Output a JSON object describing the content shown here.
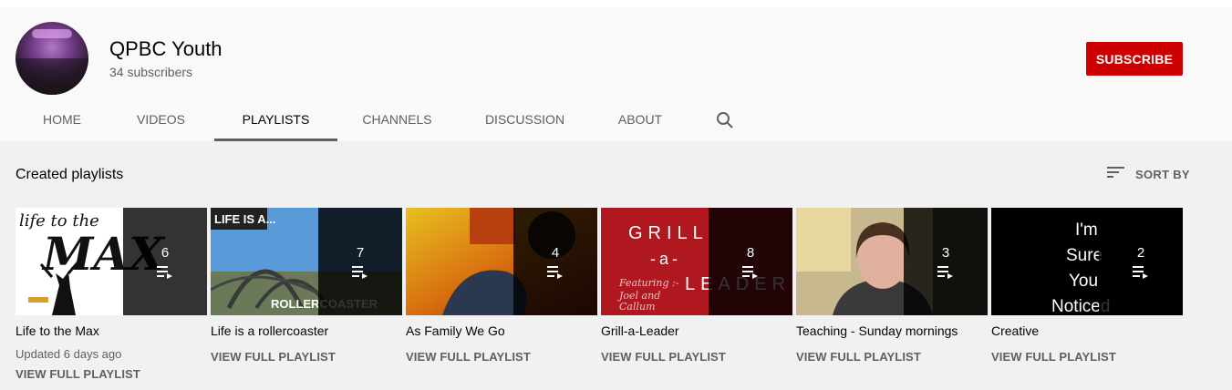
{
  "channel": {
    "name": "QPBC Youth",
    "subscribers": "34 subscribers",
    "subscribe_label": "SUBSCRIBE"
  },
  "tabs": [
    {
      "label": "HOME"
    },
    {
      "label": "VIDEOS"
    },
    {
      "label": "PLAYLISTS",
      "active": true
    },
    {
      "label": "CHANNELS"
    },
    {
      "label": "DISCUSSION"
    },
    {
      "label": "ABOUT"
    }
  ],
  "section": {
    "title": "Created playlists",
    "sort_label": "SORT BY"
  },
  "playlists": [
    {
      "title": "Life to the Max",
      "count": "6",
      "meta": "Updated 6 days ago",
      "link": "VIEW FULL PLAYLIST",
      "thumb_text": "life to the MAX"
    },
    {
      "title": "Life is a rollercoaster",
      "count": "7",
      "meta": "",
      "link": "VIEW FULL PLAYLIST",
      "thumb_text": "LIFE IS A... ROLLERCOASTER"
    },
    {
      "title": "As Family We Go",
      "count": "4",
      "meta": "",
      "link": "VIEW FULL PLAYLIST",
      "thumb_text": ""
    },
    {
      "title": "Grill-a-Leader",
      "count": "8",
      "meta": "",
      "link": "VIEW FULL PLAYLIST",
      "thumb_text": "GRILL -a- LEADER"
    },
    {
      "title": "Teaching - Sunday mornings",
      "count": "3",
      "meta": "",
      "link": "VIEW FULL PLAYLIST",
      "thumb_text": ""
    },
    {
      "title": "Creative",
      "count": "2",
      "meta": "",
      "link": "VIEW FULL PLAYLIST",
      "thumb_text": "I'm Sure You Noticed"
    }
  ],
  "colors": {
    "subscribe": "#cc0000",
    "page_bg": "#f1f1f1",
    "header_bg": "#f9f9f9"
  },
  "icons": {
    "search": "search-icon",
    "sort": "sort-icon",
    "playlist": "playlist-play-icon"
  }
}
